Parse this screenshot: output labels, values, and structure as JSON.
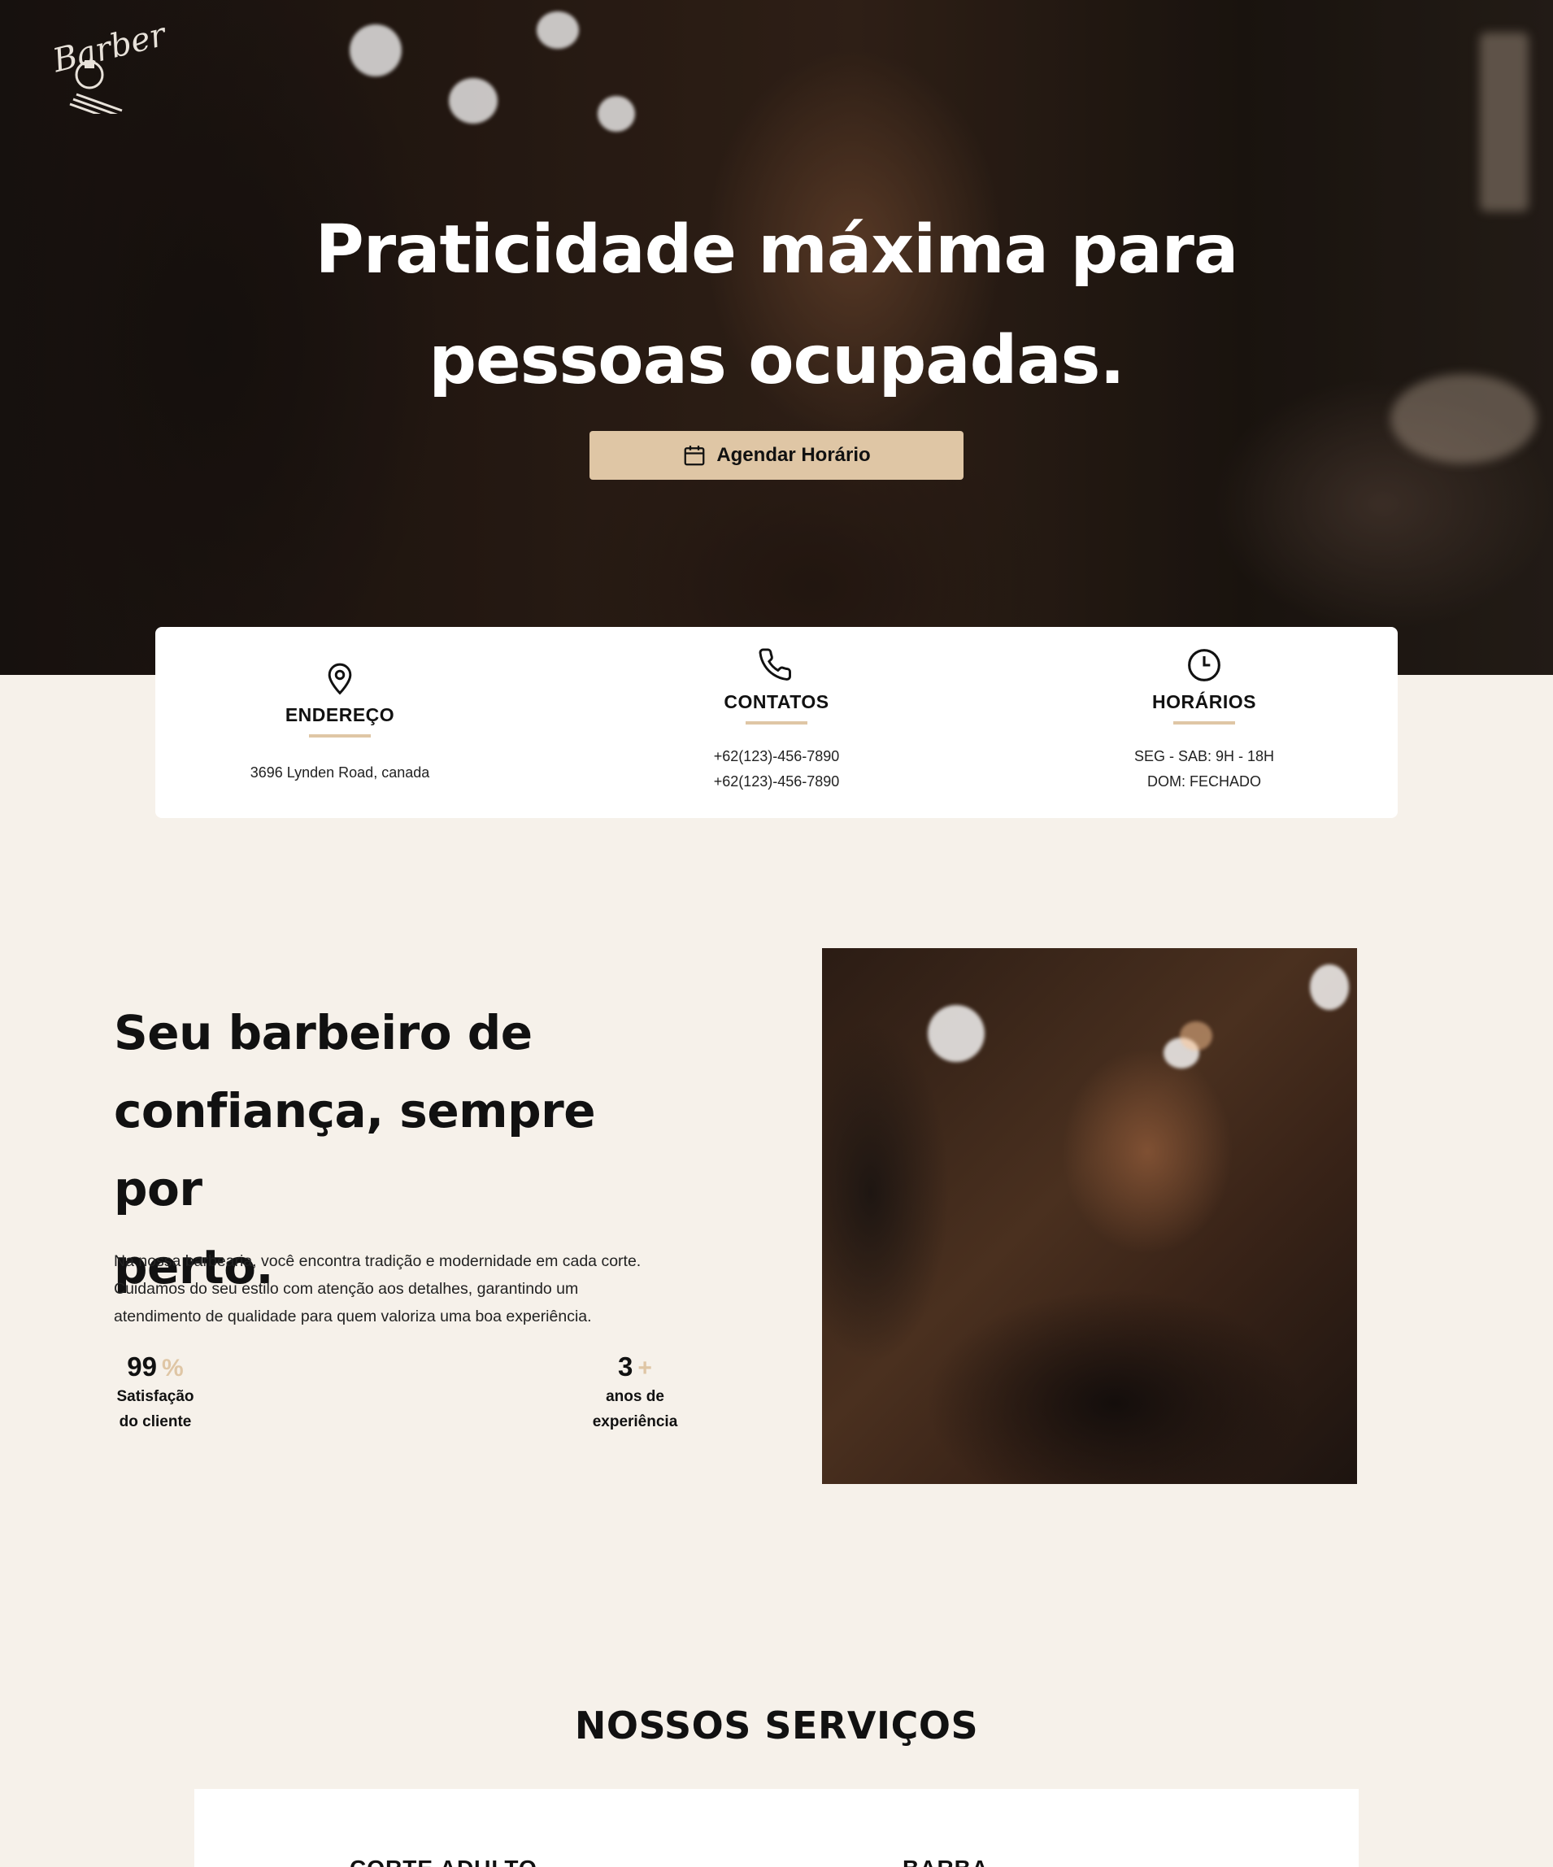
{
  "hero": {
    "logo_text": "Barber",
    "title_line1": "Praticidade máxima para",
    "title_line2": "pessoas ocupadas.",
    "cta_label": "Agendar Horário",
    "cta_icon": "calendar-icon"
  },
  "info": {
    "address": {
      "icon": "map-pin-icon",
      "title": "ENDEREÇO",
      "line1": "3696 Lynden Road, canada"
    },
    "contacts": {
      "icon": "phone-icon",
      "title": "CONTATOS",
      "line1": "+62(123)-456-7890",
      "line2": "+62(123)-456-7890"
    },
    "hours": {
      "icon": "clock-icon",
      "title": "HORÁRIOS",
      "line1": "SEG - SAB: 9H - 18H",
      "line2": "DOM: FECHADO"
    }
  },
  "about": {
    "title_line1": "Seu barbeiro de",
    "title_line2": "confiança, sempre por",
    "title_line3": "perto.",
    "text_line1": "Na nossa barbearia, você encontra tradição e modernidade em cada corte.",
    "text_line2": "Cuidamos do seu estilo com atenção aos detalhes, garantindo um",
    "text_line3": "atendimento de qualidade para quem valoriza uma boa experiência.",
    "stats": [
      {
        "value": "99",
        "suffix": "%",
        "label_line1": "Satisfação",
        "label_line2": "do cliente"
      },
      {
        "value": "3",
        "suffix": "+",
        "label_line1": "anos de",
        "label_line2": "experiência"
      }
    ]
  },
  "services": {
    "title": "NOSSOS SERVIÇOS",
    "items": [
      {
        "name": "CORTE ADULTO"
      },
      {
        "name": "BARBA"
      }
    ]
  },
  "colors": {
    "accent": "#dfc6a5",
    "background": "#f6f1ea",
    "card": "#ffffff",
    "text": "#111111"
  }
}
